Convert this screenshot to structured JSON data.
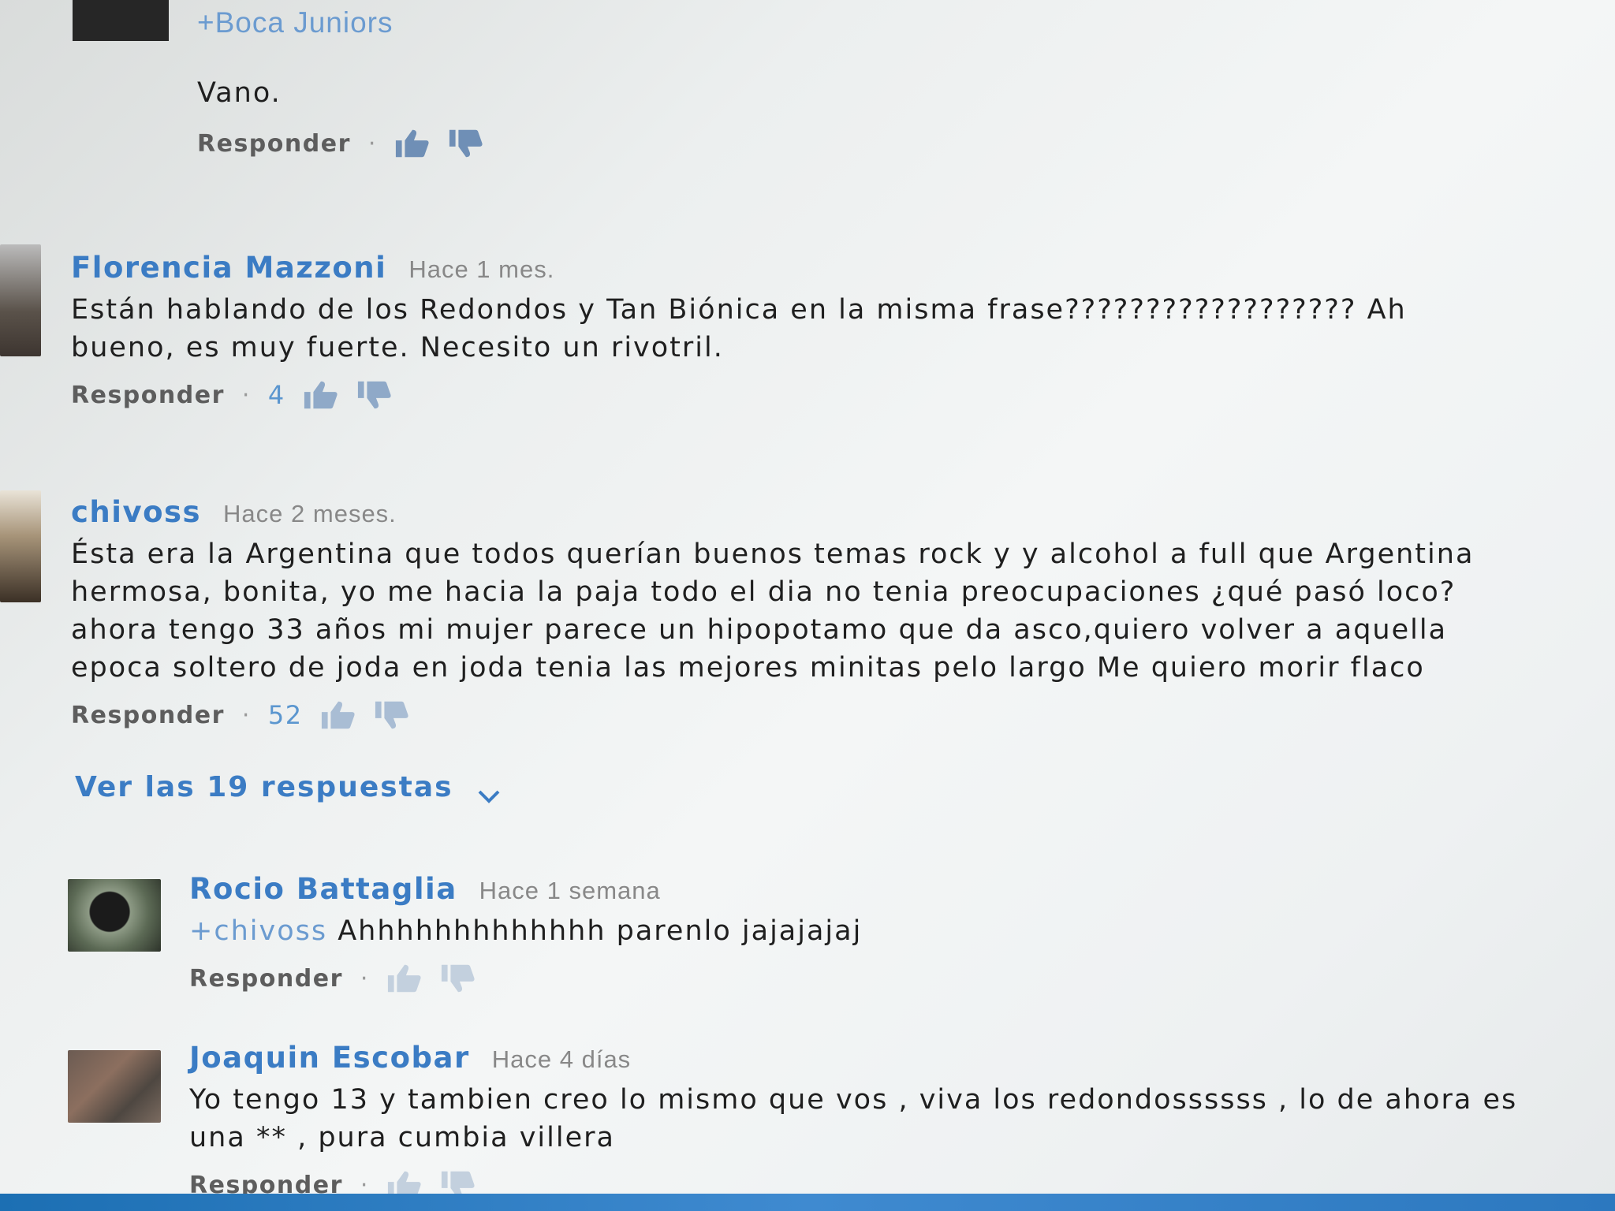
{
  "top": {
    "mention": "+Boca Juniors",
    "text": "Vano.",
    "reply": "Responder"
  },
  "comments": [
    {
      "author": "Florencia Mazzoni",
      "time": "Hace 1 mes.",
      "lines": [
        "Están hablando de los Redondos y Tan Biónica en la misma frase?????????????????? Ah",
        "bueno, es muy fuerte. Necesito un rivotril."
      ],
      "reply": "Responder",
      "likes": "4"
    },
    {
      "author": "chivoss",
      "time": "Hace 2 meses.",
      "lines": [
        "Ésta era la Argentina que todos querían buenos temas rock y y alcohol a full  que  Argentina",
        "hermosa, bonita,  yo me hacia la paja todo el dia no tenia preocupaciones ¿qué pasó loco?",
        "ahora tengo 33 años mi mujer parece un hipopotamo que da asco,quiero volver a aquella",
        "epoca soltero  de joda en joda tenia las mejores minitas pelo largo  Me quiero morir flaco"
      ],
      "reply": "Responder",
      "likes": "52",
      "view_replies": "Ver las 19 respuestas"
    }
  ],
  "replies": [
    {
      "author": "Rocio Battaglia",
      "time": "Hace 1 semana",
      "mention": "+chivoss",
      "lines": [
        " Ahhhhhhhhhhhhh parenlo jajajajaj"
      ],
      "reply": "Responder"
    },
    {
      "author": "Joaquin Escobar",
      "time": "Hace 4 días",
      "lines": [
        "Yo tengo 13 y tambien creo lo mismo que vos , viva los redondossssss , lo de ahora es",
        "una ** , pura cumbia villera"
      ],
      "reply": "Responder"
    }
  ],
  "icons": {
    "like": "thumbs-up-icon",
    "dislike": "thumbs-down-icon",
    "expand": "chevron-down-icon"
  },
  "colors": {
    "author": "#3b7cc4",
    "count": "#5b96cf",
    "mention": "#6b9bd0"
  }
}
